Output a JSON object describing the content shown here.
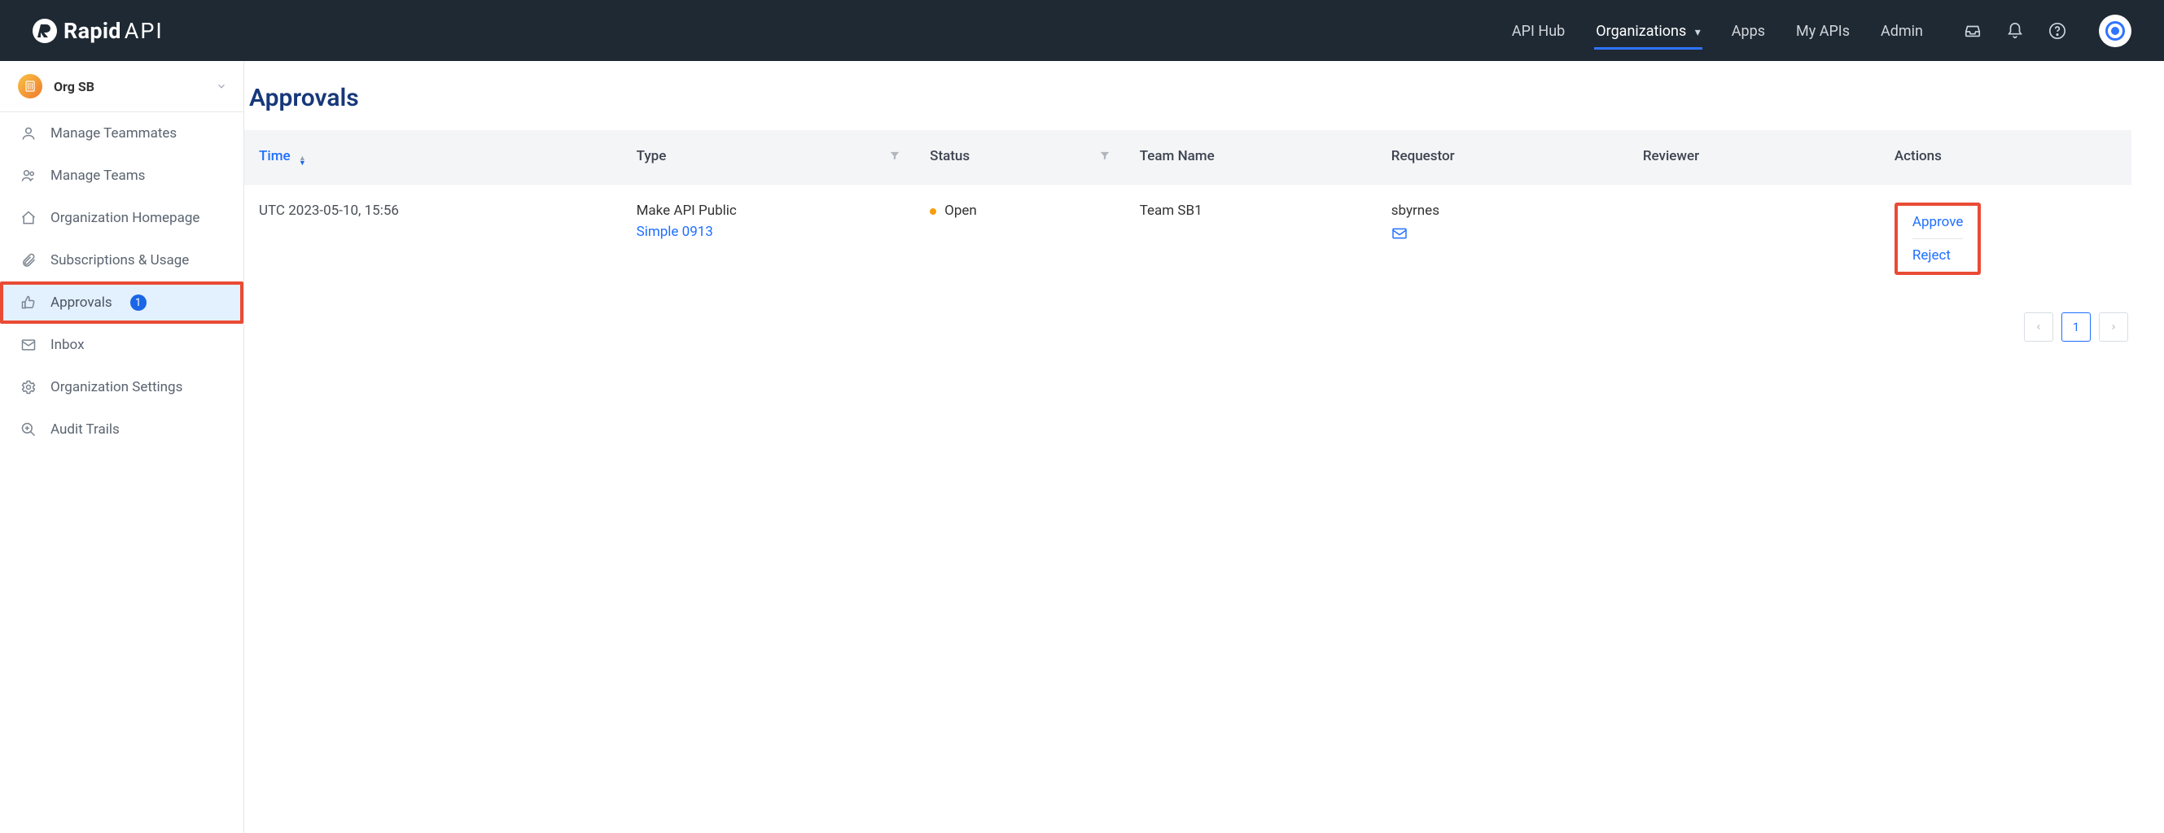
{
  "header": {
    "brand_primary": "Rapid",
    "brand_secondary": "API",
    "nav": {
      "api_hub": "API Hub",
      "organizations": "Organizations",
      "apps": "Apps",
      "my_apis": "My APIs",
      "admin": "Admin"
    }
  },
  "sidebar": {
    "org_name": "Org SB",
    "items": {
      "manage_teammates": "Manage Teammates",
      "manage_teams": "Manage Teams",
      "org_homepage": "Organization Homepage",
      "subscriptions_usage": "Subscriptions & Usage",
      "approvals": "Approvals",
      "approvals_count": "1",
      "inbox": "Inbox",
      "org_settings": "Organization Settings",
      "audit_trails": "Audit Trails"
    }
  },
  "page": {
    "title": "Approvals"
  },
  "table": {
    "headers": {
      "time": "Time",
      "type": "Type",
      "status": "Status",
      "team_name": "Team Name",
      "requestor": "Requestor",
      "reviewer": "Reviewer",
      "actions": "Actions"
    },
    "rows": [
      {
        "time": "UTC 2023-05-10, 15:56",
        "type_main": "Make API Public",
        "type_link": "Simple 0913",
        "status": "Open",
        "team_name": "Team SB1",
        "requestor": "sbyrnes",
        "reviewer": "",
        "action_approve": "Approve",
        "action_reject": "Reject"
      }
    ]
  },
  "pagination": {
    "current": "1"
  }
}
